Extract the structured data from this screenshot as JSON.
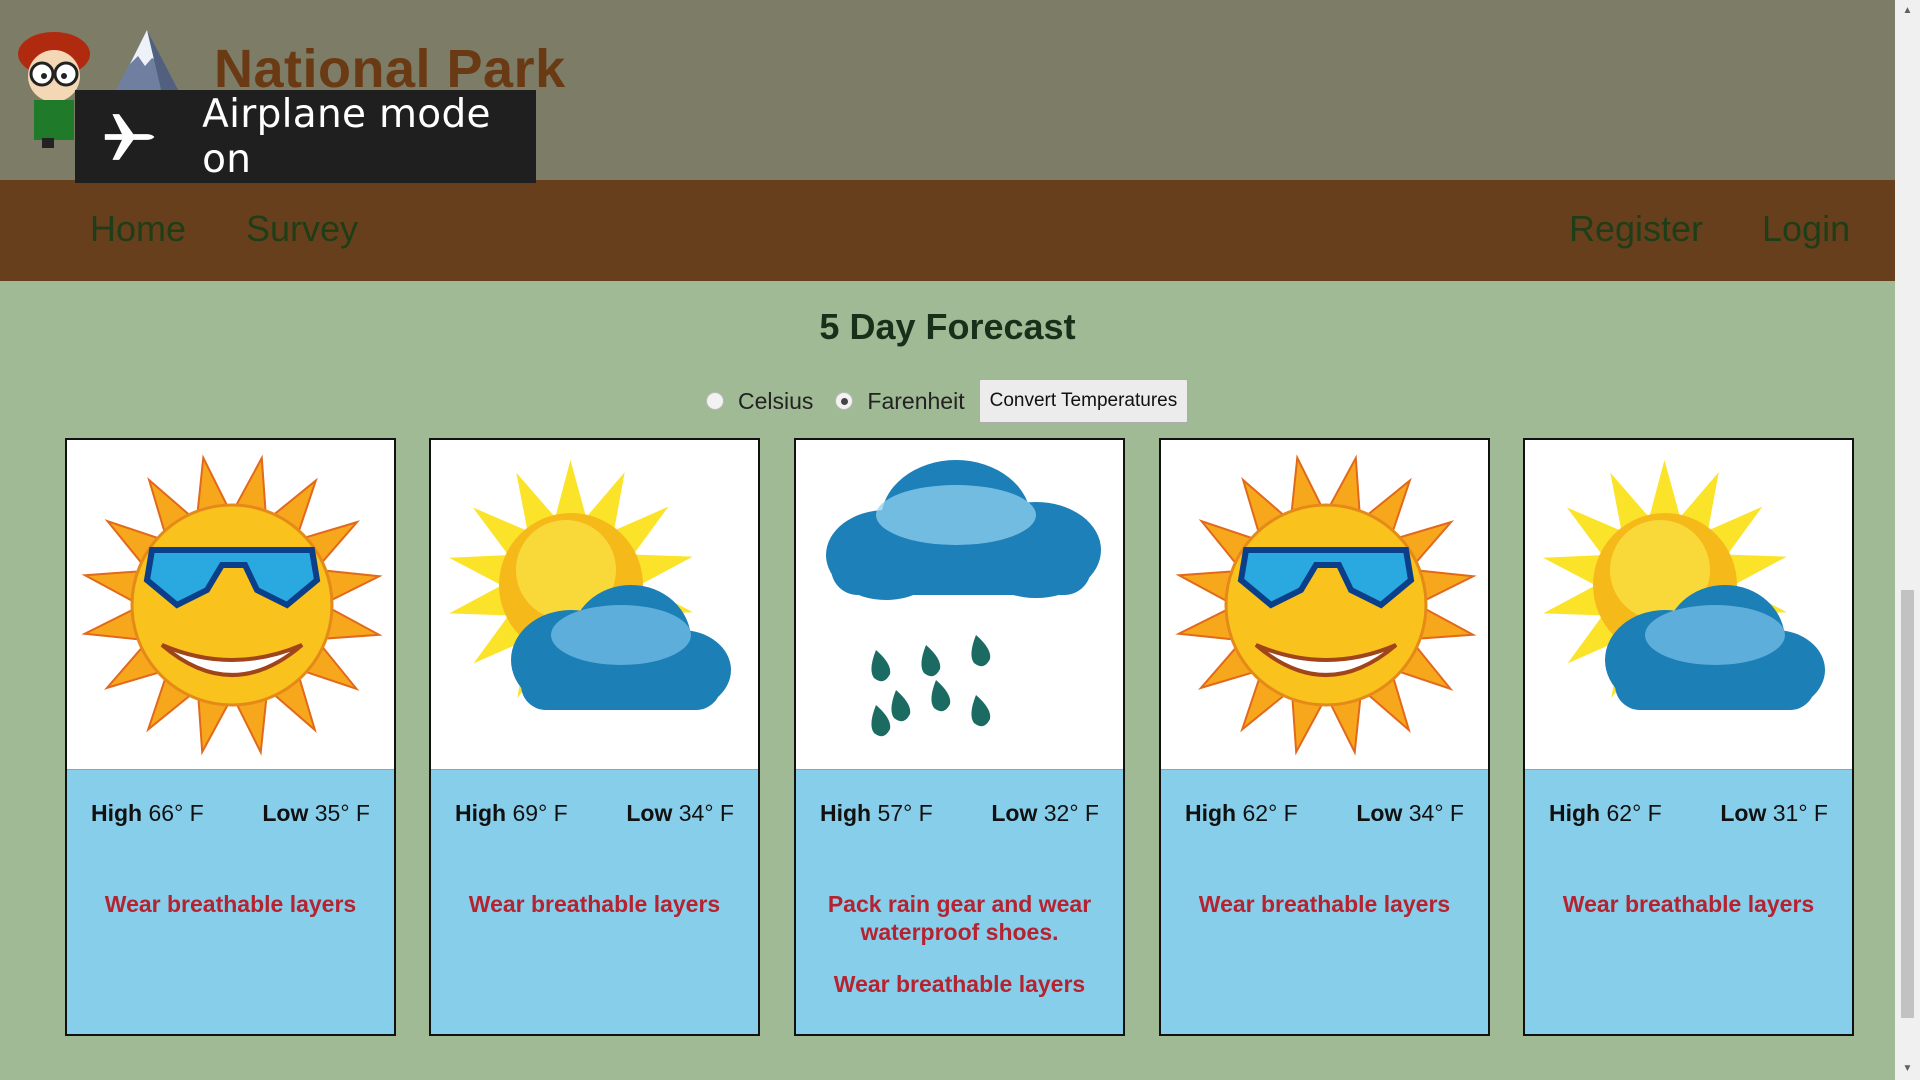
{
  "header": {
    "title": "National Park"
  },
  "nav": {
    "home": "Home",
    "survey": "Survey",
    "register": "Register",
    "login": "Login"
  },
  "toast": {
    "text": "Airplane mode on",
    "icon": "airplane-icon"
  },
  "forecast": {
    "title": "5 Day Forecast",
    "units": {
      "celsius": "Celsius",
      "farenheit": "Farenheit",
      "selected": "Farenheit"
    },
    "convert_button": "Convert Temperatures",
    "high_label": "High",
    "low_label": "Low",
    "days": [
      {
        "icon": "sunny-sunglasses-icon",
        "high": "66° F",
        "low": "35° F",
        "advice": [
          "Wear breathable layers"
        ]
      },
      {
        "icon": "partly-cloudy-icon",
        "high": "69° F",
        "low": "34° F",
        "advice": [
          "Wear breathable layers"
        ]
      },
      {
        "icon": "rain-icon",
        "high": "57° F",
        "low": "32° F",
        "advice": [
          "Pack rain gear and wear waterproof shoes.",
          "Wear breathable layers"
        ]
      },
      {
        "icon": "sunny-sunglasses-icon",
        "high": "62° F",
        "low": "34° F",
        "advice": [
          "Wear breathable layers"
        ]
      },
      {
        "icon": "partly-cloudy-icon",
        "high": "62° F",
        "low": "31° F",
        "advice": [
          "Wear breathable layers"
        ]
      }
    ]
  },
  "colors": {
    "header_bg": "#7d7c67",
    "nav_bg": "#673f1d",
    "page_bg": "#9fba95",
    "card_bg": "#87ceeb",
    "advice_text": "#b52330",
    "title_text": "#6a3a14"
  }
}
